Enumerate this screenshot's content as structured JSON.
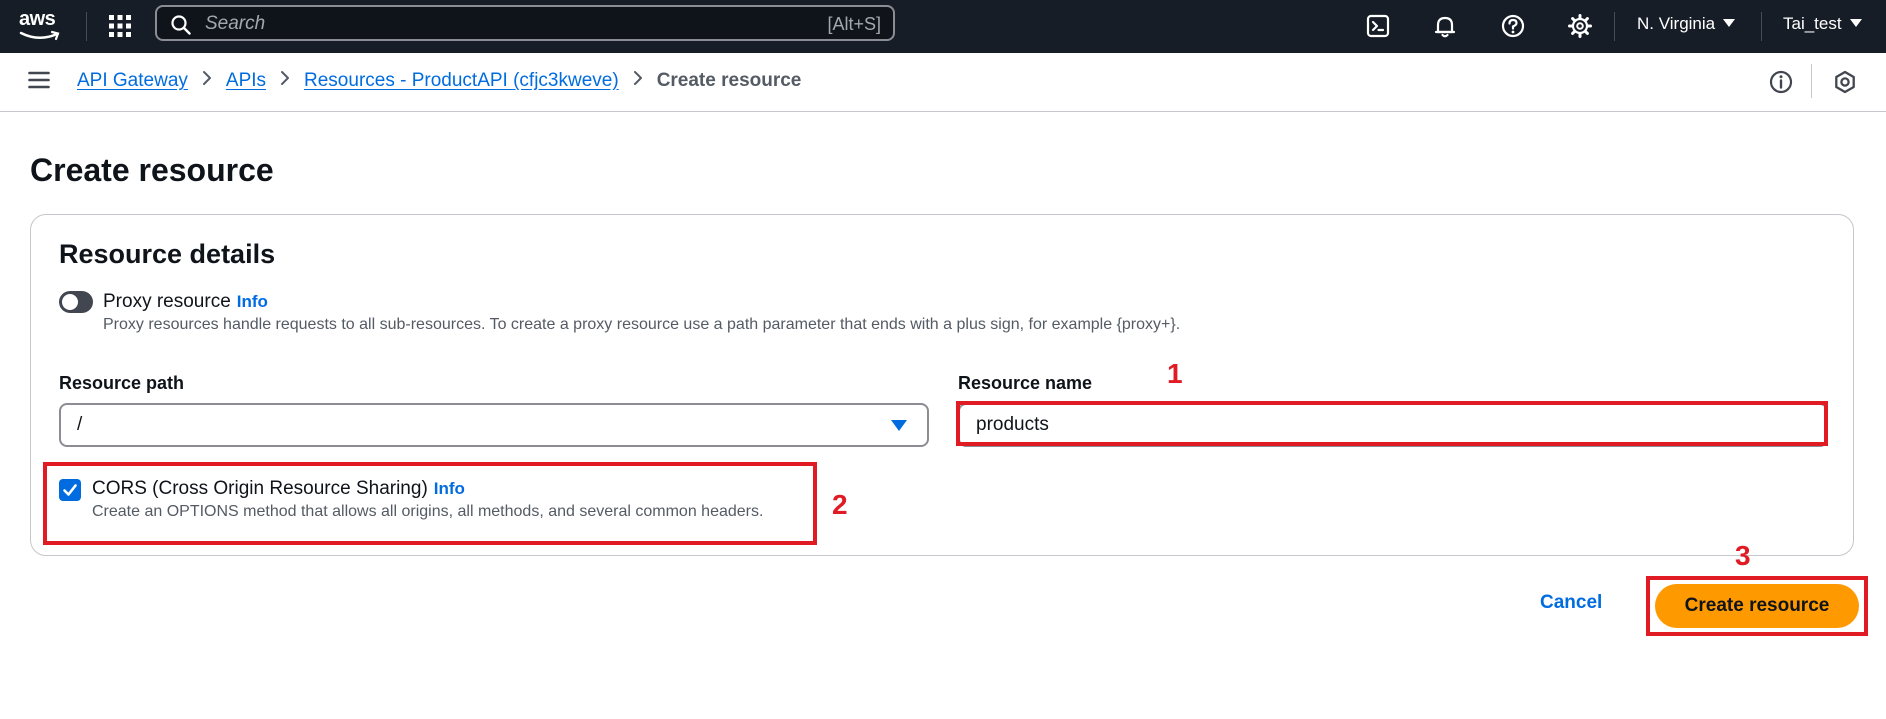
{
  "topnav": {
    "logo_text": "aws",
    "search": {
      "placeholder": "Search",
      "shortcut": "[Alt+S]"
    },
    "region": "N. Virginia",
    "account": "Tai_test",
    "icons": [
      "cloudshell-icon",
      "bell-icon",
      "help-icon",
      "gear-icon"
    ]
  },
  "breadcrumb": {
    "items": [
      "API Gateway",
      "APIs",
      "Resources - ProductAPI (cfjc3kweve)"
    ],
    "current": "Create resource"
  },
  "page": {
    "title": "Create resource"
  },
  "card": {
    "title": "Resource details",
    "proxy": {
      "label": "Proxy resource",
      "info": "Info",
      "description": "Proxy resources handle requests to all sub-resources. To create a proxy resource use a path parameter that ends with a plus sign, for example {proxy+}.",
      "enabled": false
    },
    "resource_path": {
      "label": "Resource path",
      "value": "/"
    },
    "resource_name": {
      "label": "Resource name",
      "value": "products"
    },
    "cors": {
      "label": "CORS (Cross Origin Resource Sharing)",
      "info": "Info",
      "description": "Create an OPTIONS method that allows all origins, all methods, and several common headers.",
      "checked": true
    }
  },
  "actions": {
    "cancel": "Cancel",
    "submit": "Create resource"
  },
  "annotations": {
    "one": "1",
    "two": "2",
    "three": "3"
  },
  "colors": {
    "accent": "#006ce0",
    "primary_button": "#ff9900",
    "nav_bg": "#161d26",
    "annotation": "#e01b24"
  }
}
